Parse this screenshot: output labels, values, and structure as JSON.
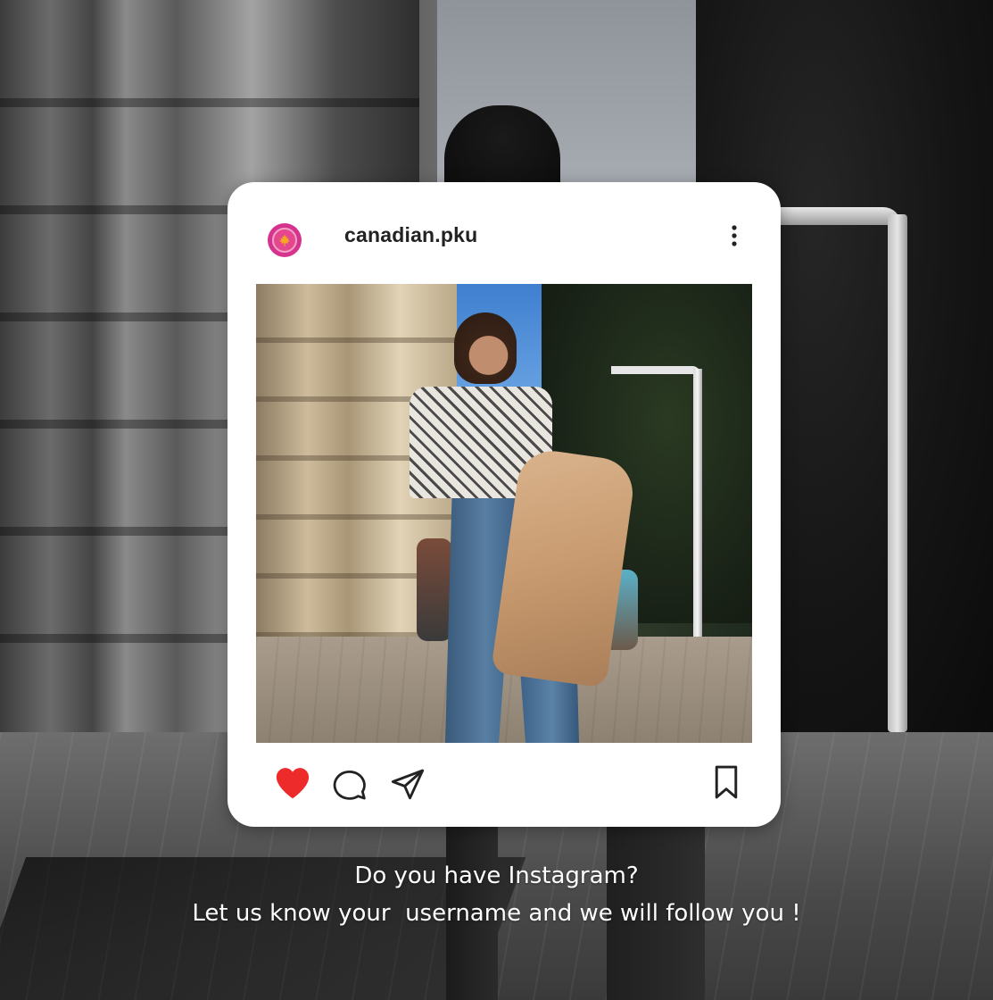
{
  "post": {
    "username": "canadian.pku",
    "avatar_icon": "maple-leaf-icon",
    "avatar_colors": {
      "outer": "#d6338f",
      "leaf": "#f5a623"
    },
    "like_color": "#ed2b2b"
  },
  "actions": {
    "icons": [
      "heart-icon",
      "comment-icon",
      "share-icon",
      "bookmark-icon"
    ]
  },
  "caption": {
    "line1": "Do you have Instagram?",
    "line2": "Let us know your  username and we will follow you !"
  }
}
